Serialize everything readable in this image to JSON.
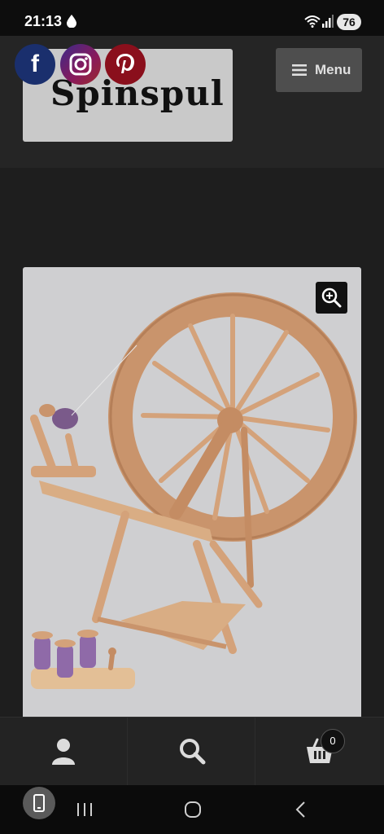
{
  "status_bar": {
    "time": "21:13",
    "battery": "76",
    "icons": [
      "drop-icon",
      "wifi-icon",
      "signal-icon"
    ]
  },
  "header": {
    "logo_text": "Spinspul",
    "social": [
      {
        "name": "facebook",
        "glyph": "f",
        "color": "#1a2f6d"
      },
      {
        "name": "instagram",
        "glyph": "",
        "color": "#8a1a5a"
      },
      {
        "name": "pinterest",
        "glyph": "",
        "color": "#8a0f1c"
      }
    ],
    "menu_label": "Menu"
  },
  "product": {
    "image_subject": "spinning-wheel",
    "zoom_icon": "zoom-in-icon"
  },
  "bottom_nav": {
    "items": [
      "account-icon",
      "search-icon",
      "cart-icon"
    ],
    "cart_count": "0"
  },
  "system_nav": {
    "items": [
      "recents-icon",
      "home-icon",
      "back-icon"
    ]
  },
  "colors": {
    "background": "#1e1e1e",
    "header": "#252525",
    "logo_box": "#c9c9c9",
    "menu_button": "#4e4e4e",
    "product_bg": "#cfcfd1",
    "wood": "#c9946c"
  }
}
